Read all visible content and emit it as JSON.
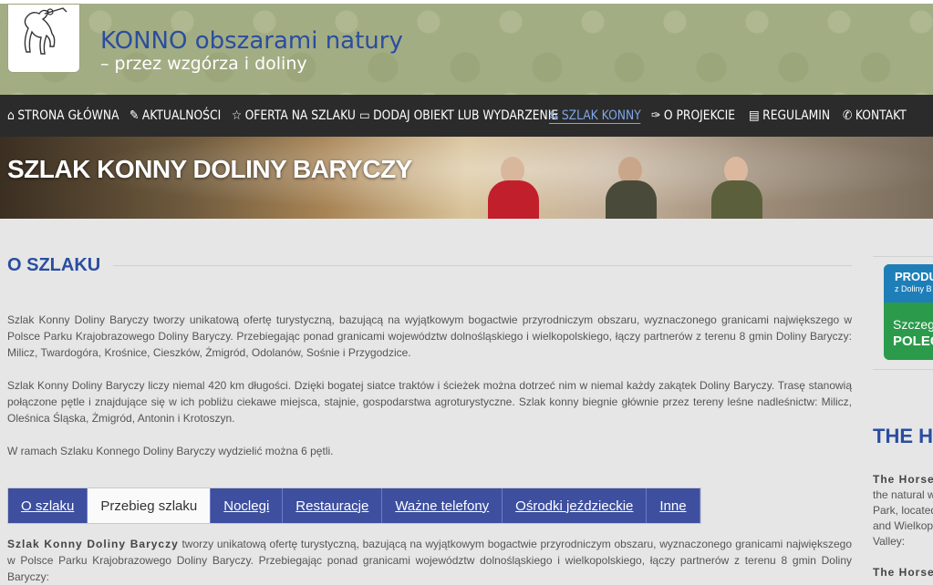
{
  "site": {
    "title": "KONNO obszarami natury",
    "subtitle": "– przez wzgórza i doliny"
  },
  "nav": [
    {
      "icon": "home-icon",
      "glyph": "⌂",
      "label": "STRONA GŁÓWNA"
    },
    {
      "icon": "pencil-icon",
      "glyph": "✎",
      "label": "AKTUALNOŚCI"
    },
    {
      "icon": "star-icon",
      "glyph": "☆",
      "label": "OFERTA NA SZLAKU"
    },
    {
      "icon": "laptop-icon",
      "glyph": "▭",
      "label": "DODAJ OBIEKT LUB WYDARZENIE"
    },
    {
      "icon": "signpost-icon",
      "glyph": "⇆",
      "label": "SZLAK KONNY"
    },
    {
      "icon": "pen-nib-icon",
      "glyph": "✑",
      "label": "O PROJEKCIE"
    },
    {
      "icon": "document-icon",
      "glyph": "▤",
      "label": "REGULAMIN"
    },
    {
      "icon": "phone-icon",
      "glyph": "✆",
      "label": "KONTAKT"
    }
  ],
  "active_nav": "SZLAK KONNY",
  "banner": {
    "title": "SZLAK KONNY DOLINY BARYCZY"
  },
  "main": {
    "heading": "O SZLAKU",
    "paragraphs": [
      "Szlak Konny Doliny Baryczy tworzy unikatową ofertę turystyczną, bazującą na wyjątkowym bogactwie przyrodniczym obszaru, wyznaczonego granicami największego w Polsce Parku Krajobrazowego Doliny Baryczy. Przebiegając ponad granicami województw dolnośląskiego i wielkopolskiego, łączy partnerów z terenu 8 gmin Doliny Baryczy: Milicz, Twardogóra, Krośnice, Cieszków, Żmigród, Odolanów, Sośnie i Przygodzice.",
      "Szlak Konny Doliny Baryczy liczy niemal 420 km długości. Dzięki bogatej siatce traktów i ścieżek można dotrzeć nim w niemal każdy zakątek Doliny Baryczy. Trasę stanowią połączone pętle i znajdujące się w ich pobliżu ciekawe miejsca, stajnie, gospodarstwa agroturystyczne. Szlak konny biegnie głównie przez tereny leśne nadleśnictw: Milicz, Oleśnica Śląska, Żmigród, Antonin i Krotoszyn.",
      "W ramach Szlaku Konnego Doliny Baryczy wydzielić można 6 pętli."
    ]
  },
  "tabs": [
    {
      "label": "O szlaku",
      "active": false
    },
    {
      "label": "Przebieg szlaku",
      "active": true
    },
    {
      "label": "Noclegi",
      "active": false
    },
    {
      "label": "Restauracje",
      "active": false
    },
    {
      "label": "Ważne telefony",
      "active": false
    },
    {
      "label": "Ośrodki jeździeckie",
      "active": false
    },
    {
      "label": "Inne",
      "active": false
    }
  ],
  "tab_content": {
    "lead": "Szlak Konny Doliny Baryczy",
    "rest": " tworzy unikatową ofertę turystyczną, bazującą na wyjątkowym bogactwie przyrodniczym obszaru, wyznaczonego granicami największego w Polsce Parku Krajobrazowego Doliny Baryczy. Przebiegając ponad granicami województw dolnośląskiego i wielkopolskiego, łączy partnerów z terenu 8 gmin Doliny Baryczy:"
  },
  "sidebar": {
    "promo": {
      "line1": "PRODU",
      "line2": "z Doliny B",
      "line3": "Szczegó",
      "line4": "POLECA"
    },
    "title": "THE HO",
    "text_lead": "The Horse",
    "text_lines": [
      "the natural w",
      "Park, located",
      "and Wielkopo",
      "Valley:"
    ],
    "text_lead2": "The Horse"
  },
  "colors": {
    "accent": "#2a4da0",
    "nav_bg": "#2b2b2b",
    "tab_bg": "#3d4f9e",
    "header_bg": "#a3ad83"
  }
}
